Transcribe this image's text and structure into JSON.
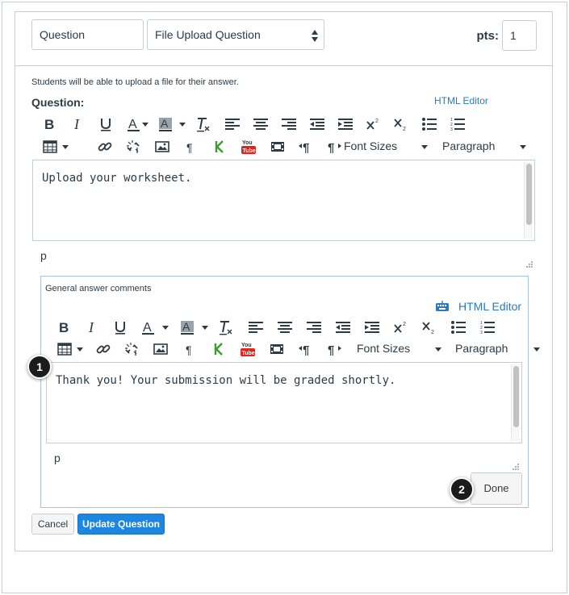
{
  "header": {
    "title_value": "Question",
    "question_type": "File Upload Question",
    "points_label": "pts:",
    "points_value": "1"
  },
  "question": {
    "hint": "Students will be able to upload a file for their answer.",
    "label": "Question:",
    "html_editor_label": "HTML Editor",
    "font_sizes_label": "Font Sizes",
    "format_label": "Paragraph",
    "content": "Upload your worksheet.",
    "path": "p"
  },
  "comments": {
    "label": "General answer comments",
    "html_editor_label": "HTML Editor",
    "font_sizes_label": "Font Sizes",
    "format_label": "Paragraph",
    "content": "Thank you! Your submission will be graded shortly.",
    "path": "p",
    "done_label": "Done"
  },
  "footer": {
    "cancel_label": "Cancel",
    "update_label": "Update Question"
  },
  "callouts": {
    "one": "1",
    "two": "2"
  },
  "colors": {
    "accent": "#2b7abc",
    "primary_button": "#1d86e0",
    "border": "#c7cdd1",
    "comments_border": "#a8c3df",
    "youtube_red": "#e62117",
    "kaltura_green": "#3f9b2f"
  },
  "icons": {
    "toolbar_row1": [
      "bold-icon",
      "italic-icon",
      "underline-icon",
      "text-color-icon",
      "background-color-icon",
      "clear-formatting-icon",
      "align-left-icon",
      "align-center-icon",
      "align-right-icon",
      "outdent-icon",
      "indent-icon",
      "superscript-icon",
      "subscript-icon",
      "bullet-list-icon",
      "numbered-list-icon"
    ],
    "toolbar_row2": [
      "table-icon",
      "link-icon",
      "unlink-icon",
      "image-icon",
      "pilcrow-icon",
      "kaltura-icon",
      "youtube-icon",
      "media-icon",
      "ltr-icon",
      "rtl-icon"
    ]
  }
}
